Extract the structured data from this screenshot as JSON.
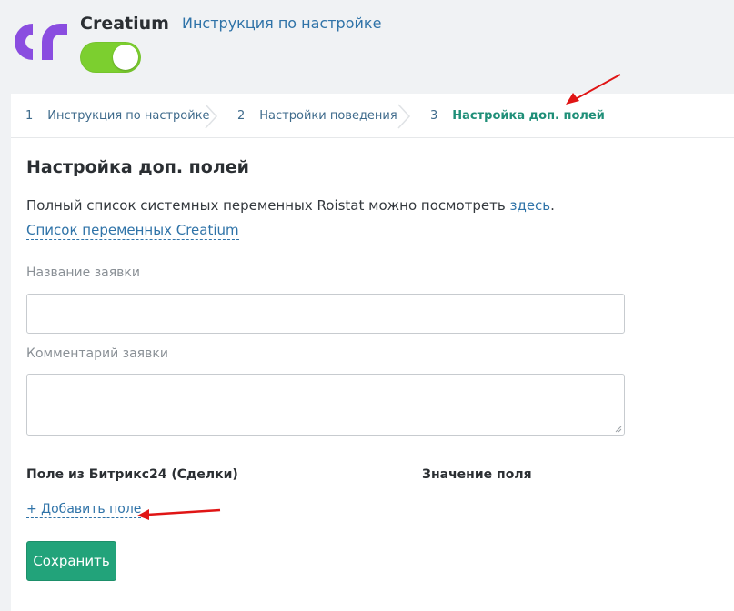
{
  "header": {
    "app_name": "Creatium",
    "help_link": "Инструкция по настройке",
    "toggle_on": true
  },
  "steps": [
    {
      "num": "1",
      "label": "Инструкция по настройке",
      "active": false
    },
    {
      "num": "2",
      "label": "Настройки поведения",
      "active": false
    },
    {
      "num": "3",
      "label": "Настройка доп. полей",
      "active": true
    }
  ],
  "main": {
    "title": "Настройка доп. полей",
    "description_prefix": "Полный список системных переменных Roistat можно посмотреть ",
    "description_link": "здесь",
    "description_suffix": ".",
    "variables_link": "Список переменных Creatium",
    "fields": {
      "request_name_label": "Название заявки",
      "request_name_value": "",
      "request_comment_label": "Комментарий заявки",
      "request_comment_value": ""
    },
    "mapping": {
      "col_field": "Поле из Битрикс24 (Сделки)",
      "col_value": "Значение поля",
      "add_field": "+ Добавить поле"
    },
    "save_label": "Сохранить"
  },
  "colors": {
    "logo": "#8a4de0",
    "toggle": "#7ccf2f",
    "link": "#2f73a8",
    "active_step": "#1f8f78",
    "save_button": "#22a37a",
    "annotation_arrow": "#e01515"
  }
}
